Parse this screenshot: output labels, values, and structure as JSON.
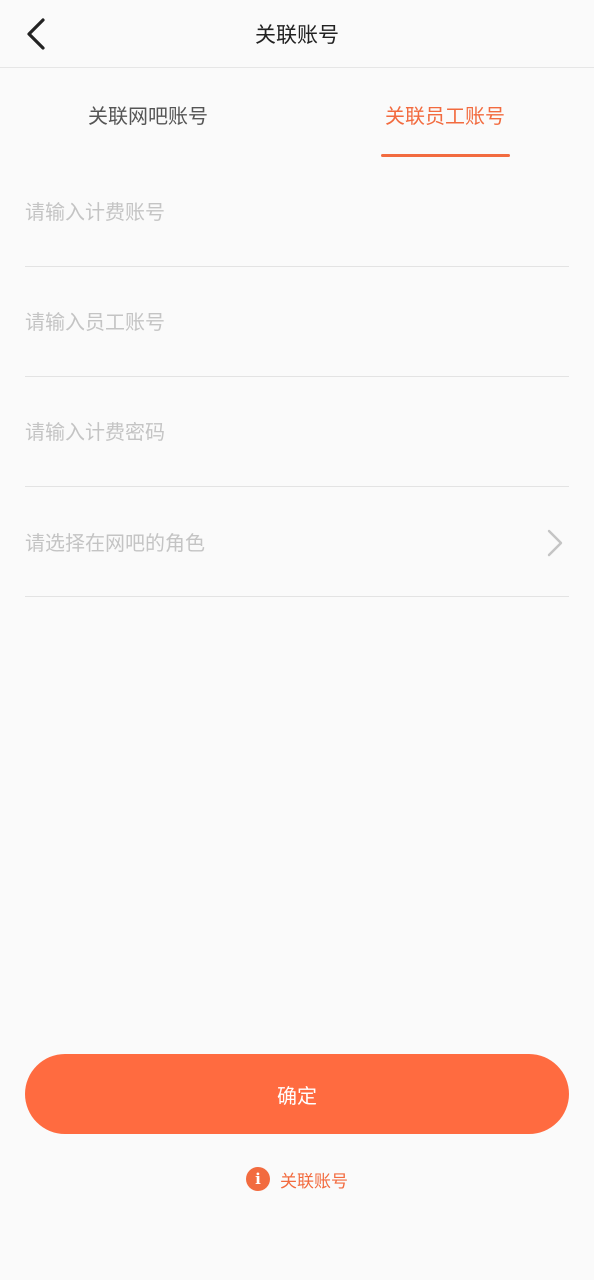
{
  "header": {
    "title": "关联账号",
    "back_icon": "chevron-left-icon"
  },
  "tabs": [
    {
      "label": "关联网吧账号",
      "active": false
    },
    {
      "label": "关联员工账号",
      "active": true
    }
  ],
  "form": {
    "billing_account": {
      "placeholder": "请输入计费账号",
      "value": ""
    },
    "staff_account": {
      "placeholder": "请输入员工账号",
      "value": ""
    },
    "billing_password": {
      "placeholder": "请输入计费密码",
      "value": ""
    },
    "role_select": {
      "placeholder": "请选择在网吧的角色",
      "icon": "chevron-right-icon"
    }
  },
  "confirm_label": "确定",
  "info_link": {
    "label": "关联账号",
    "icon": "info-icon"
  },
  "colors": {
    "accent": "#ff6b40",
    "tab_active": "#f26b3f",
    "placeholder": "#c4c4c4",
    "background": "#fafafa"
  }
}
